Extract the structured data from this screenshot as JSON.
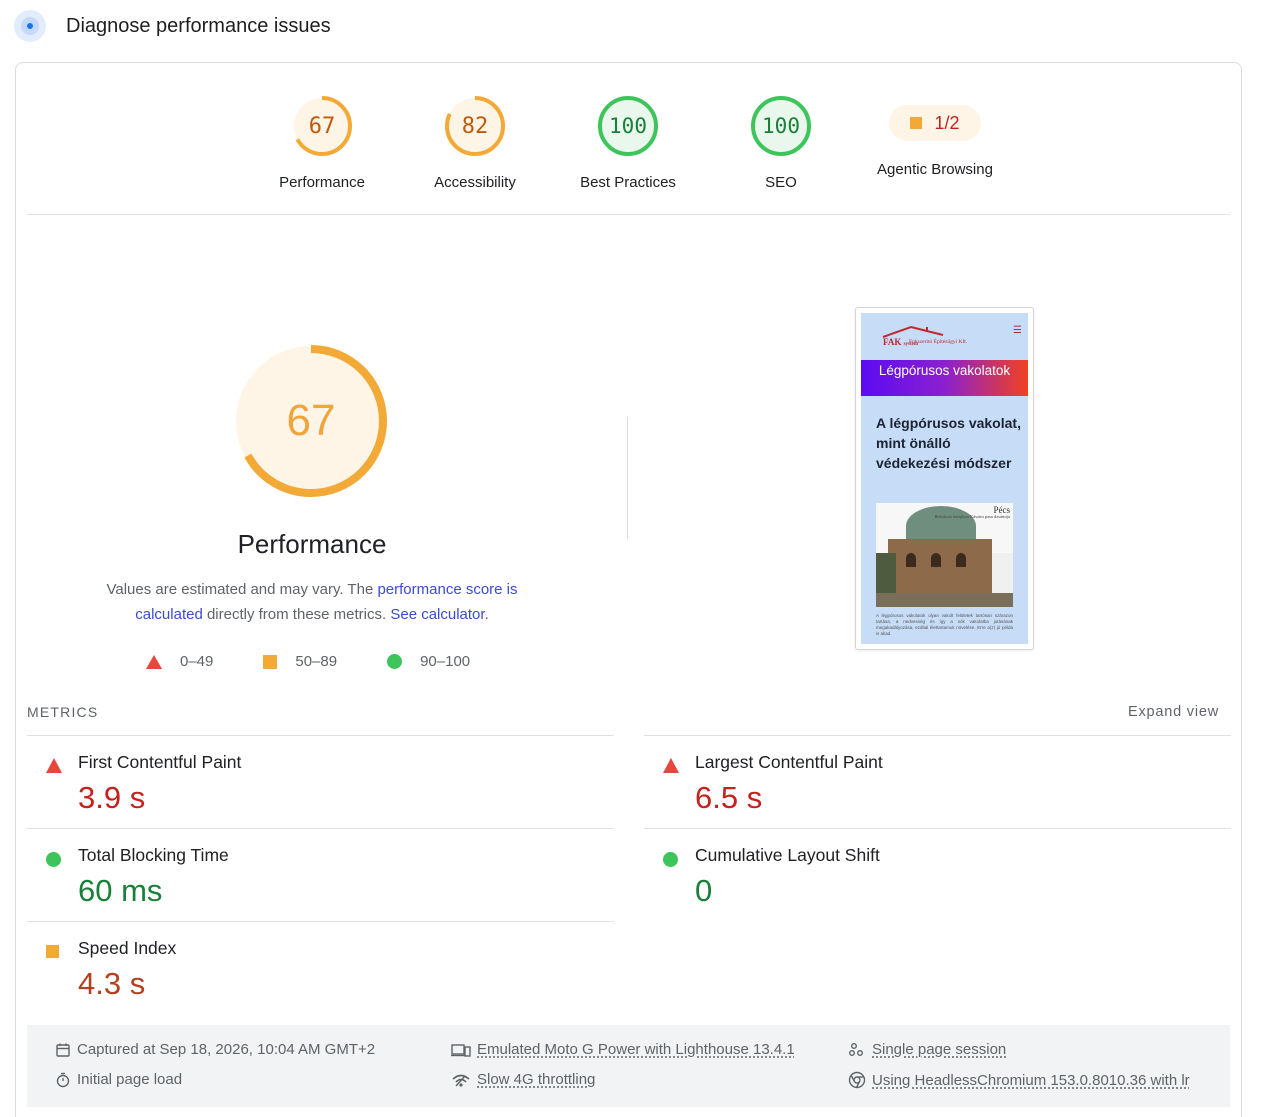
{
  "header": {
    "title": "Diagnose performance issues"
  },
  "gauges": [
    {
      "score": "67",
      "label": "Performance",
      "level": "average",
      "fraction": 0.67
    },
    {
      "score": "82",
      "label": "Accessibility",
      "level": "average",
      "fraction": 0.82
    },
    {
      "score": "100",
      "label": "Best Practices",
      "level": "pass",
      "fraction": 1.0
    },
    {
      "score": "100",
      "label": "SEO",
      "level": "pass",
      "fraction": 1.0
    }
  ],
  "agentic": {
    "value": "1/2",
    "label": "Agentic Browsing"
  },
  "performance": {
    "score": "67",
    "fraction": 0.67,
    "title": "Performance",
    "desc_start": "Values are estimated and may vary. The ",
    "desc_link": "performance score is calculated",
    "desc_mid": " directly from these metrics. ",
    "desc_link2": "See calculator",
    "desc_end": "."
  },
  "legend": {
    "fail": "0–49",
    "average": "50–89",
    "pass": "90–100"
  },
  "screenshot": {
    "brand": "FAK",
    "brand_small": "system",
    "brand_sub": "Fukszeritó Építésügyi Kft.",
    "banner": "Légpórusos vakolatok",
    "heading": "A légpórusos vakolat, mint önálló védekezési módszer",
    "photo_caption": "Pécs",
    "photo_caption_small": "Belvárosi templom Kászim pasa dzsámija",
    "para": "A légpórusos vakolatok olyan vakolt felületek tartósan szárazon tartása, a nedvesség és így a sók vakolatba jutásának megakadályozása, ezáltal élettartamuk növelése. Erre a(z) jó példa is akad."
  },
  "metrics": {
    "header": "METRICS",
    "expand": "Expand view",
    "items": [
      {
        "label": "First Contentful Paint",
        "value": "3.9 s",
        "rating": "fail"
      },
      {
        "label": "Largest Contentful Paint",
        "value": "6.5 s",
        "rating": "fail"
      },
      {
        "label": "Total Blocking Time",
        "value": "60 ms",
        "rating": "pass"
      },
      {
        "label": "Cumulative Layout Shift",
        "value": "0",
        "rating": "pass"
      },
      {
        "label": "Speed Index",
        "value": "4.3 s",
        "rating": "average"
      }
    ]
  },
  "footer": {
    "captured": "Captured at Sep 18, 2026, 10:04 AM GMT+2",
    "load": "Initial page load",
    "device": "Emulated Moto G Power with Lighthouse 13.4.1",
    "throttling": "Slow 4G throttling",
    "session": "Single page session",
    "browser": "Using HeadlessChromium 153.0.8010.36 with lr"
  },
  "colors": {
    "average_ring": "#f3a936",
    "average_fill": "#fef5e7",
    "average_text": "#c05a0a",
    "pass_ring": "#3dc55c",
    "pass_fill": "#e9f7ed",
    "pass_text": "#188038",
    "fail": "#e8453c",
    "link": "#3c4ad7"
  }
}
